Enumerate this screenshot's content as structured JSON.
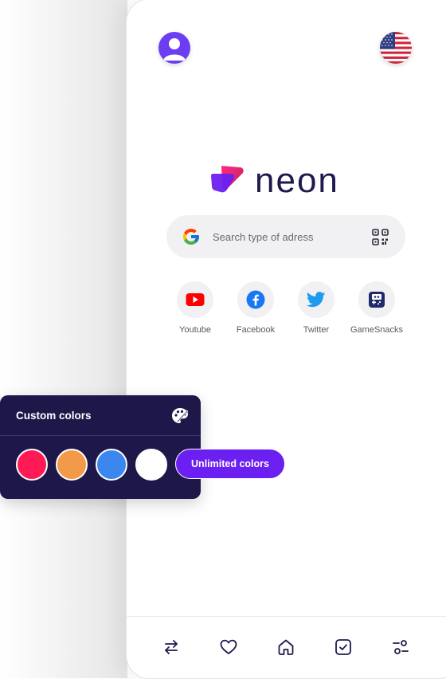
{
  "brand": {
    "name": "neon"
  },
  "search": {
    "placeholder": "Search type of adress"
  },
  "shortcuts": [
    {
      "label": "Youtube",
      "icon": "youtube-icon"
    },
    {
      "label": "Facebook",
      "icon": "facebook-icon"
    },
    {
      "label": "Twitter",
      "icon": "twitter-icon"
    },
    {
      "label": "GameSnacks",
      "icon": "gamesnacks-icon"
    }
  ],
  "custom_colors": {
    "title": "Custom colors",
    "swatches": [
      "#ff1a55",
      "#f29a4a",
      "#3b86ef",
      "#ffffff"
    ],
    "button_label": "Unlimited colors"
  },
  "nav": {
    "icons": [
      "swap-arrows-icon",
      "heart-icon",
      "home-icon",
      "checkbox-icon",
      "settings-sliders-icon"
    ]
  },
  "colors": {
    "accent": "#6b1ff0",
    "panel": "#1e174a",
    "brand_text": "#1e1a4d"
  }
}
